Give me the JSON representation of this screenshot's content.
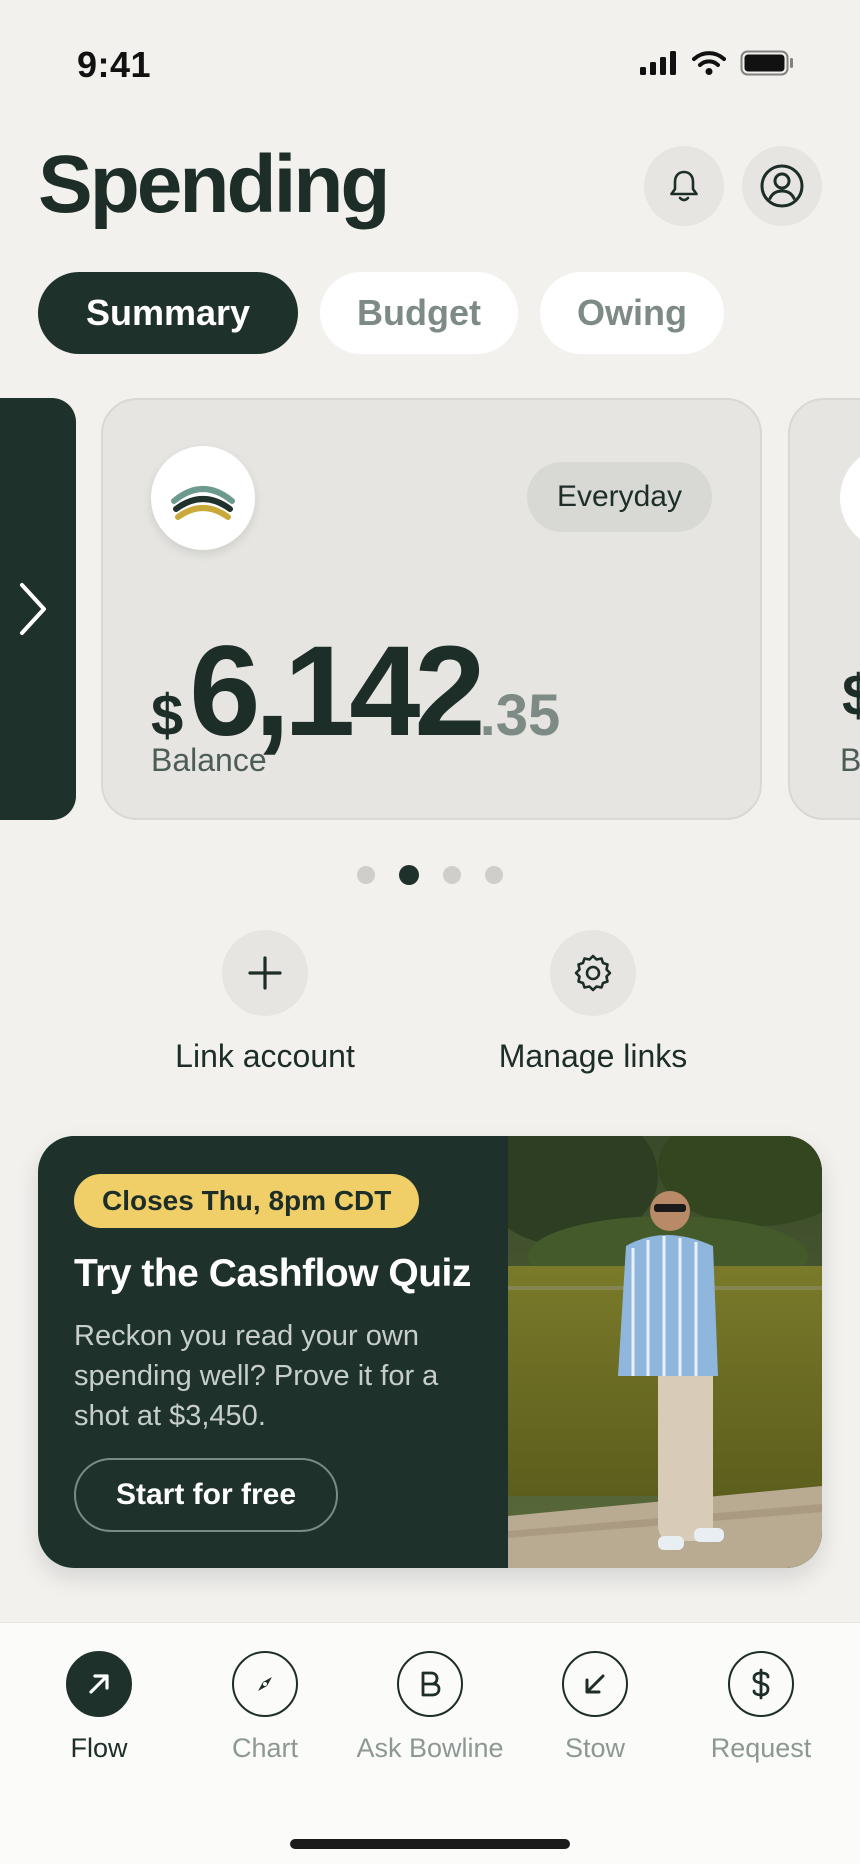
{
  "status_bar": {
    "time": "9:41"
  },
  "header": {
    "title": "Spending"
  },
  "tabs": [
    {
      "label": "Summary",
      "active": true
    },
    {
      "label": "Budget",
      "active": false
    },
    {
      "label": "Owing",
      "active": false
    }
  ],
  "account_card": {
    "badge": "Everyday",
    "currency_symbol": "$",
    "balance_whole": "6,142",
    "balance_cents": ".35",
    "balance_label": "Balance"
  },
  "next_card": {
    "currency_symbol": "$",
    "label_initial": "B"
  },
  "carousel": {
    "page_count": 4,
    "active_index": 1
  },
  "actions": {
    "link_account": "Link account",
    "manage_links": "Manage links"
  },
  "promo": {
    "badge": "Closes Thu, 8pm CDT",
    "title": "Try the Cashflow Quiz",
    "body": "Reckon you read your own spending well? Prove it for a shot at $3,450.",
    "button": "Start for free"
  },
  "nav": [
    {
      "label": "Flow",
      "icon": "arrow-up-right-icon",
      "active": true
    },
    {
      "label": "Chart",
      "icon": "compass-icon",
      "active": false
    },
    {
      "label": "Ask Bowline",
      "icon": "bowline-b-icon",
      "active": false
    },
    {
      "label": "Stow",
      "icon": "arrow-down-left-icon",
      "active": false
    },
    {
      "label": "Request",
      "icon": "dollar-icon",
      "active": false
    }
  ],
  "colors": {
    "background": "#f2f1ee",
    "primary_dark": "#1e312b",
    "card_bg": "#e6e5e1",
    "promo_badge": "#f0cf69",
    "muted_text": "#8d9894"
  }
}
